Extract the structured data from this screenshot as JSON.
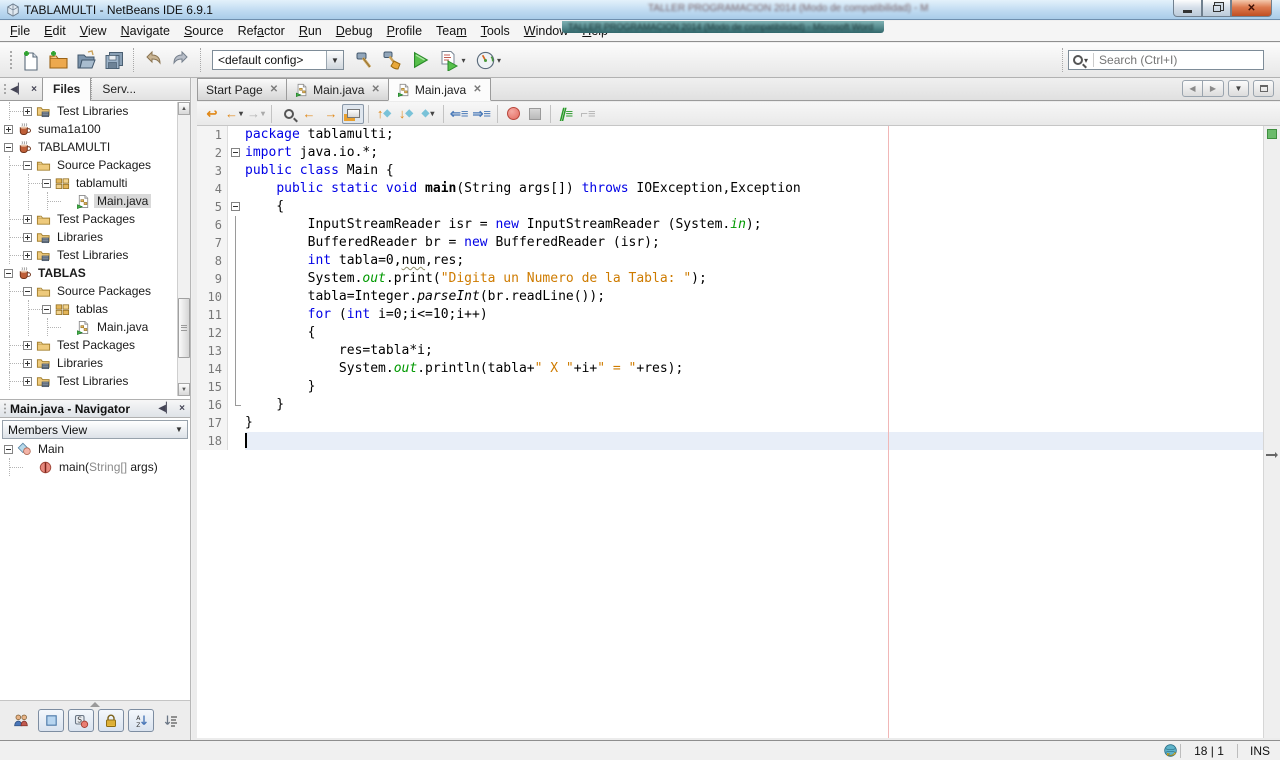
{
  "window": {
    "title": "TABLAMULTI - NetBeans IDE 6.9.1",
    "background_title": "TALLER PROGRAMACION 2014 (Modo de compatibilidad) - Microsoft Word"
  },
  "menu": {
    "items": [
      {
        "label": "File",
        "underline": 0
      },
      {
        "label": "Edit",
        "underline": 0
      },
      {
        "label": "View",
        "underline": 0
      },
      {
        "label": "Navigate",
        "underline": 0
      },
      {
        "label": "Source",
        "underline": 0
      },
      {
        "label": "Refactor",
        "underline": 3
      },
      {
        "label": "Run",
        "underline": 0
      },
      {
        "label": "Debug",
        "underline": 0
      },
      {
        "label": "Profile",
        "underline": 0
      },
      {
        "label": "Team",
        "underline": 3
      },
      {
        "label": "Tools",
        "underline": 0
      },
      {
        "label": "Window",
        "underline": 0
      },
      {
        "label": "Help",
        "underline": 0
      }
    ]
  },
  "toolbar": {
    "config": "<default config>",
    "search_placeholder": "Search (Ctrl+I)"
  },
  "sidebar": {
    "tabs": [
      {
        "label": "Files",
        "active": true
      },
      {
        "label": "Serv...",
        "active": false
      }
    ],
    "tree": [
      {
        "indent": 1,
        "expand": "plus",
        "icon": "folderlib",
        "label": "Test Libraries"
      },
      {
        "indent": 0,
        "expand": "plus",
        "icon": "coffee",
        "label": "suma1a100"
      },
      {
        "indent": 0,
        "expand": "minus",
        "icon": "coffee",
        "label": "TABLAMULTI"
      },
      {
        "indent": 1,
        "expand": "minus",
        "icon": "folder",
        "label": "Source Packages"
      },
      {
        "indent": 2,
        "expand": "minus",
        "icon": "package",
        "label": "tablamulti"
      },
      {
        "indent": 3,
        "expand": "none",
        "icon": "java",
        "label": "Main.java",
        "selected": true
      },
      {
        "indent": 1,
        "expand": "plus",
        "icon": "folder",
        "label": "Test Packages"
      },
      {
        "indent": 1,
        "expand": "plus",
        "icon": "folderlib",
        "label": "Libraries"
      },
      {
        "indent": 1,
        "expand": "plus",
        "icon": "folderlib",
        "label": "Test Libraries"
      },
      {
        "indent": 0,
        "expand": "minus",
        "icon": "coffee",
        "label": "TABLAS",
        "bold": true
      },
      {
        "indent": 1,
        "expand": "minus",
        "icon": "folder",
        "label": "Source Packages"
      },
      {
        "indent": 2,
        "expand": "minus",
        "icon": "package",
        "label": "tablas"
      },
      {
        "indent": 3,
        "expand": "none",
        "icon": "java",
        "label": "Main.java"
      },
      {
        "indent": 1,
        "expand": "plus",
        "icon": "folder",
        "label": "Test Packages"
      },
      {
        "indent": 1,
        "expand": "plus",
        "icon": "folderlib",
        "label": "Libraries"
      },
      {
        "indent": 1,
        "expand": "plus",
        "icon": "folderlib",
        "label": "Test Libraries"
      }
    ]
  },
  "navigator": {
    "title": "Main.java - Navigator",
    "view_selector": "Members View",
    "items": [
      {
        "indent": 0,
        "expand": "minus",
        "icon": "class",
        "parts": [
          [
            "pl",
            "Main"
          ]
        ]
      },
      {
        "indent": 1,
        "expand": "none",
        "icon": "method",
        "parts": [
          [
            "pl",
            "main("
          ],
          [
            "gray",
            "String[]"
          ],
          [
            "pl",
            " args)"
          ]
        ]
      }
    ]
  },
  "editor": {
    "tabs": [
      {
        "label": "Start Page",
        "icon": false,
        "active": false
      },
      {
        "label": "Main.java",
        "icon": true,
        "active": false
      },
      {
        "label": "Main.java",
        "icon": true,
        "active": true
      }
    ],
    "code": {
      "lines": [
        {
          "n": 1,
          "fold": "",
          "t": [
            [
              "kw",
              "package"
            ],
            [
              "pl",
              " tablamulti;"
            ]
          ]
        },
        {
          "n": 2,
          "fold": "box",
          "t": [
            [
              "kw",
              "import"
            ],
            [
              "pl",
              " java.io.*;"
            ]
          ]
        },
        {
          "n": 3,
          "fold": "",
          "t": [
            [
              "kw",
              "public"
            ],
            [
              "pl",
              " "
            ],
            [
              "kw",
              "class"
            ],
            [
              "pl",
              " Main {"
            ]
          ]
        },
        {
          "n": 4,
          "fold": "",
          "t": [
            [
              "pl",
              "    "
            ],
            [
              "kw",
              "public"
            ],
            [
              "pl",
              " "
            ],
            [
              "kw",
              "static"
            ],
            [
              "pl",
              " "
            ],
            [
              "kw",
              "void"
            ],
            [
              "pl",
              " "
            ],
            [
              "b",
              "main"
            ],
            [
              "pl",
              "(String args[]) "
            ],
            [
              "kw",
              "throws"
            ],
            [
              "pl",
              " IOException,Exception"
            ]
          ]
        },
        {
          "n": 5,
          "fold": "box",
          "t": [
            [
              "pl",
              "    {"
            ]
          ]
        },
        {
          "n": 6,
          "fold": "v",
          "t": [
            [
              "pl",
              "        InputStreamReader isr = "
            ],
            [
              "kw",
              "new"
            ],
            [
              "pl",
              " InputStreamReader (System."
            ],
            [
              "fld",
              "in"
            ],
            [
              "pl",
              ");"
            ]
          ]
        },
        {
          "n": 7,
          "fold": "v",
          "t": [
            [
              "pl",
              "        BufferedReader br = "
            ],
            [
              "kw",
              "new"
            ],
            [
              "pl",
              " BufferedReader (isr);"
            ]
          ]
        },
        {
          "n": 8,
          "fold": "v",
          "t": [
            [
              "pl",
              "        "
            ],
            [
              "kw",
              "int"
            ],
            [
              "pl",
              " tabla=0,"
            ],
            [
              "warn",
              "num"
            ],
            [
              "pl",
              ",res;"
            ]
          ]
        },
        {
          "n": 9,
          "fold": "v",
          "t": [
            [
              "pl",
              "        System."
            ],
            [
              "fld",
              "out"
            ],
            [
              "pl",
              ".print("
            ],
            [
              "str",
              "\"Digita un Numero de la Tabla: \""
            ],
            [
              "pl",
              ");"
            ]
          ]
        },
        {
          "n": 10,
          "fold": "v",
          "t": [
            [
              "pl",
              "        tabla=Integer."
            ],
            [
              "ita",
              "parseInt"
            ],
            [
              "pl",
              "(br.readLine());"
            ]
          ]
        },
        {
          "n": 11,
          "fold": "v",
          "t": [
            [
              "pl",
              "        "
            ],
            [
              "kw",
              "for"
            ],
            [
              "pl",
              " ("
            ],
            [
              "kw",
              "int"
            ],
            [
              "pl",
              " i=0;i<=10;i++)"
            ]
          ]
        },
        {
          "n": 12,
          "fold": "v",
          "t": [
            [
              "pl",
              "        {"
            ]
          ]
        },
        {
          "n": 13,
          "fold": "v",
          "t": [
            [
              "pl",
              "            res=tabla*i;"
            ]
          ]
        },
        {
          "n": 14,
          "fold": "v",
          "t": [
            [
              "pl",
              "            System."
            ],
            [
              "fld",
              "out"
            ],
            [
              "pl",
              ".println(tabla+"
            ],
            [
              "str",
              "\" X \""
            ],
            [
              "pl",
              "+i+"
            ],
            [
              "str",
              "\" = \""
            ],
            [
              "pl",
              "+res);"
            ]
          ]
        },
        {
          "n": 15,
          "fold": "v",
          "t": [
            [
              "pl",
              "        }"
            ]
          ]
        },
        {
          "n": 16,
          "fold": "end",
          "t": [
            [
              "pl",
              "    }"
            ]
          ]
        },
        {
          "n": 17,
          "fold": "",
          "t": [
            [
              "pl",
              "}"
            ]
          ]
        },
        {
          "n": 18,
          "fold": "",
          "t": [],
          "cursor": true,
          "current": true
        }
      ]
    }
  },
  "status": {
    "cursor": "18 | 1",
    "mode": "INS"
  }
}
